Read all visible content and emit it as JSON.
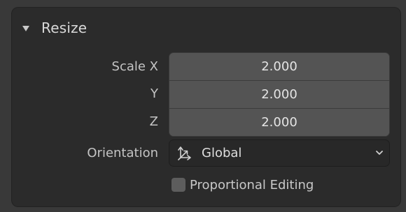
{
  "panel": {
    "title": "Resize",
    "expanded": true
  },
  "scale": {
    "label_x": "Scale X",
    "label_y": "Y",
    "label_z": "Z",
    "x": "2.000",
    "y": "2.000",
    "z": "2.000"
  },
  "orientation": {
    "label": "Orientation",
    "value": "Global",
    "icon": "orientation-axes-icon"
  },
  "proportional_editing": {
    "label": "Proportional Editing",
    "checked": false
  },
  "colors": {
    "background": "#393939",
    "panel": "#2b2b2b",
    "field": "#545454",
    "dropdown": "#282828",
    "text": "#d6d6d6"
  }
}
